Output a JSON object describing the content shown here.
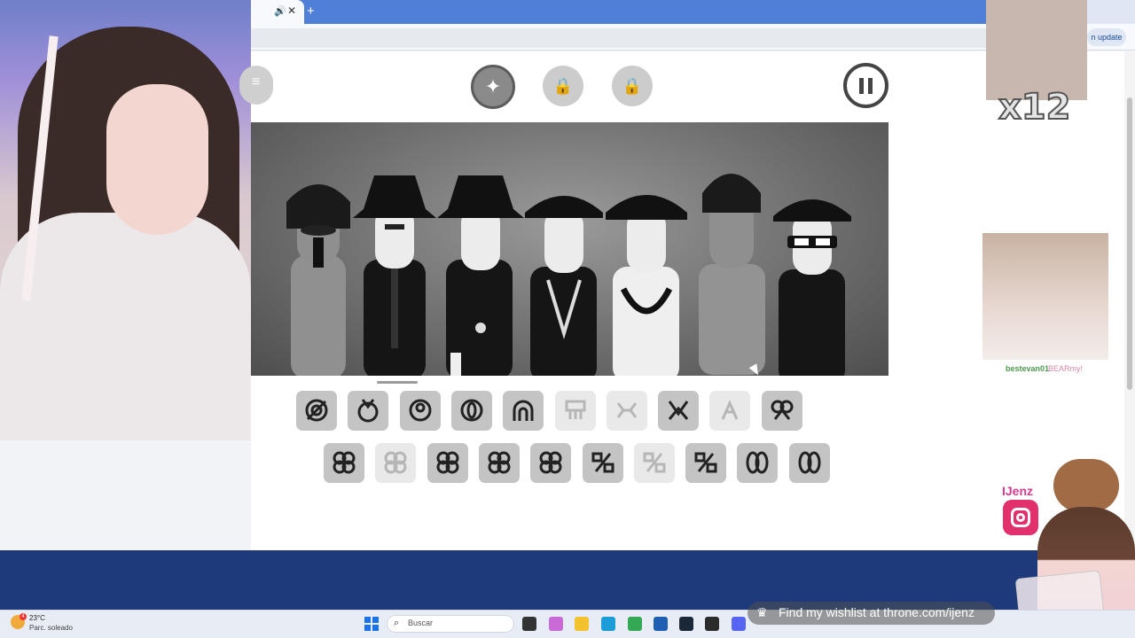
{
  "browser": {
    "update_label": "n update"
  },
  "game": {
    "menu_icon": "hamburger-icon",
    "bonus_icon": "sparkle-icon",
    "lock_icon": "lock-icon",
    "pause_icon": "pause-icon",
    "accent": "#8a8a8a",
    "sound_rows": [
      [
        {
          "icon": "beat-1",
          "enabled": true
        },
        {
          "icon": "beat-2",
          "enabled": true
        },
        {
          "icon": "beat-3",
          "enabled": true
        },
        {
          "icon": "beat-4",
          "enabled": true
        },
        {
          "icon": "beat-5",
          "enabled": true
        },
        {
          "icon": "effect-1",
          "enabled": false
        },
        {
          "icon": "effect-2",
          "enabled": false
        },
        {
          "icon": "effect-3",
          "enabled": true
        },
        {
          "icon": "effect-4",
          "enabled": false
        },
        {
          "icon": "effect-5",
          "enabled": true
        }
      ],
      [
        {
          "icon": "melody-1",
          "enabled": true
        },
        {
          "icon": "melody-2",
          "enabled": false
        },
        {
          "icon": "melody-3",
          "enabled": true
        },
        {
          "icon": "melody-4",
          "enabled": true
        },
        {
          "icon": "melody-5",
          "enabled": true
        },
        {
          "icon": "voice-1",
          "enabled": true
        },
        {
          "icon": "voice-2",
          "enabled": false
        },
        {
          "icon": "voice-3",
          "enabled": true
        },
        {
          "icon": "voice-4",
          "enabled": true
        },
        {
          "icon": "voice-5",
          "enabled": true
        }
      ]
    ]
  },
  "overlay": {
    "multiplier": "x12",
    "sub_name": "bestevan01",
    "sub_tag": "BEARmy!",
    "instagram_handle": "IJenz",
    "wishlist": "Find my wishlist at throne.com/ijenz"
  },
  "taskbar": {
    "temperature": "23°C",
    "weather": "Parc. soleado",
    "weather_badge": "4",
    "search_placeholder": "Buscar"
  }
}
